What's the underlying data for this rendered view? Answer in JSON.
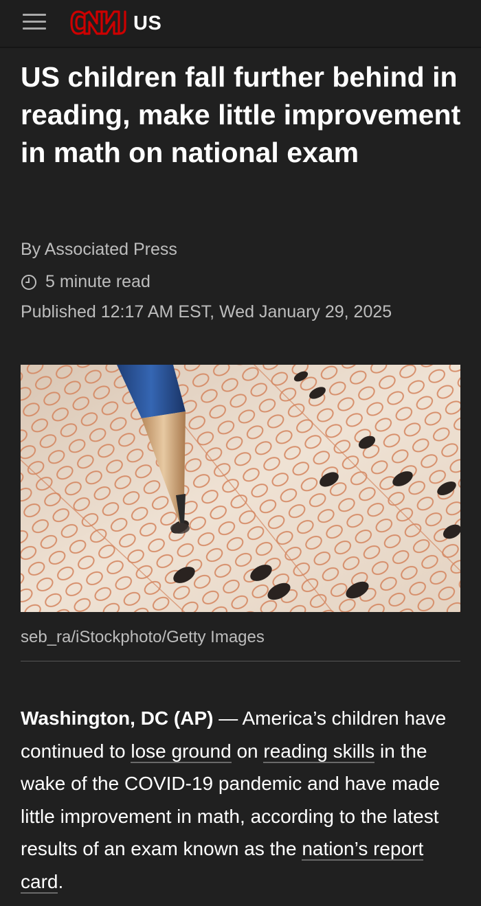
{
  "header": {
    "brand": "CNN",
    "edition": "US",
    "logo_color": "#cc0000"
  },
  "article": {
    "headline": "US children fall further behind in reading, make little improvement in math on national exam",
    "byline": "By Associated Press",
    "read_time": "5 minute read",
    "published": "Published 12:17 AM EST, Wed January 29, 2025",
    "image_caption": "seb_ra/iStockphoto/Getty Images",
    "paragraph": {
      "dateline": "Washington, DC (AP)",
      "dash": " — ",
      "text1": "America’s children have continued to ",
      "link1": "lose ground",
      "text2": " on ",
      "link2": "reading skills",
      "text3": " in the wake of the COVID-19 pandemic and have made little improvement in math, according to the latest results of an exam known as the ",
      "link3": "nation’s report card",
      "text4": "."
    }
  },
  "icons": {
    "menu": "hamburger-icon",
    "clock": "clock-icon"
  }
}
